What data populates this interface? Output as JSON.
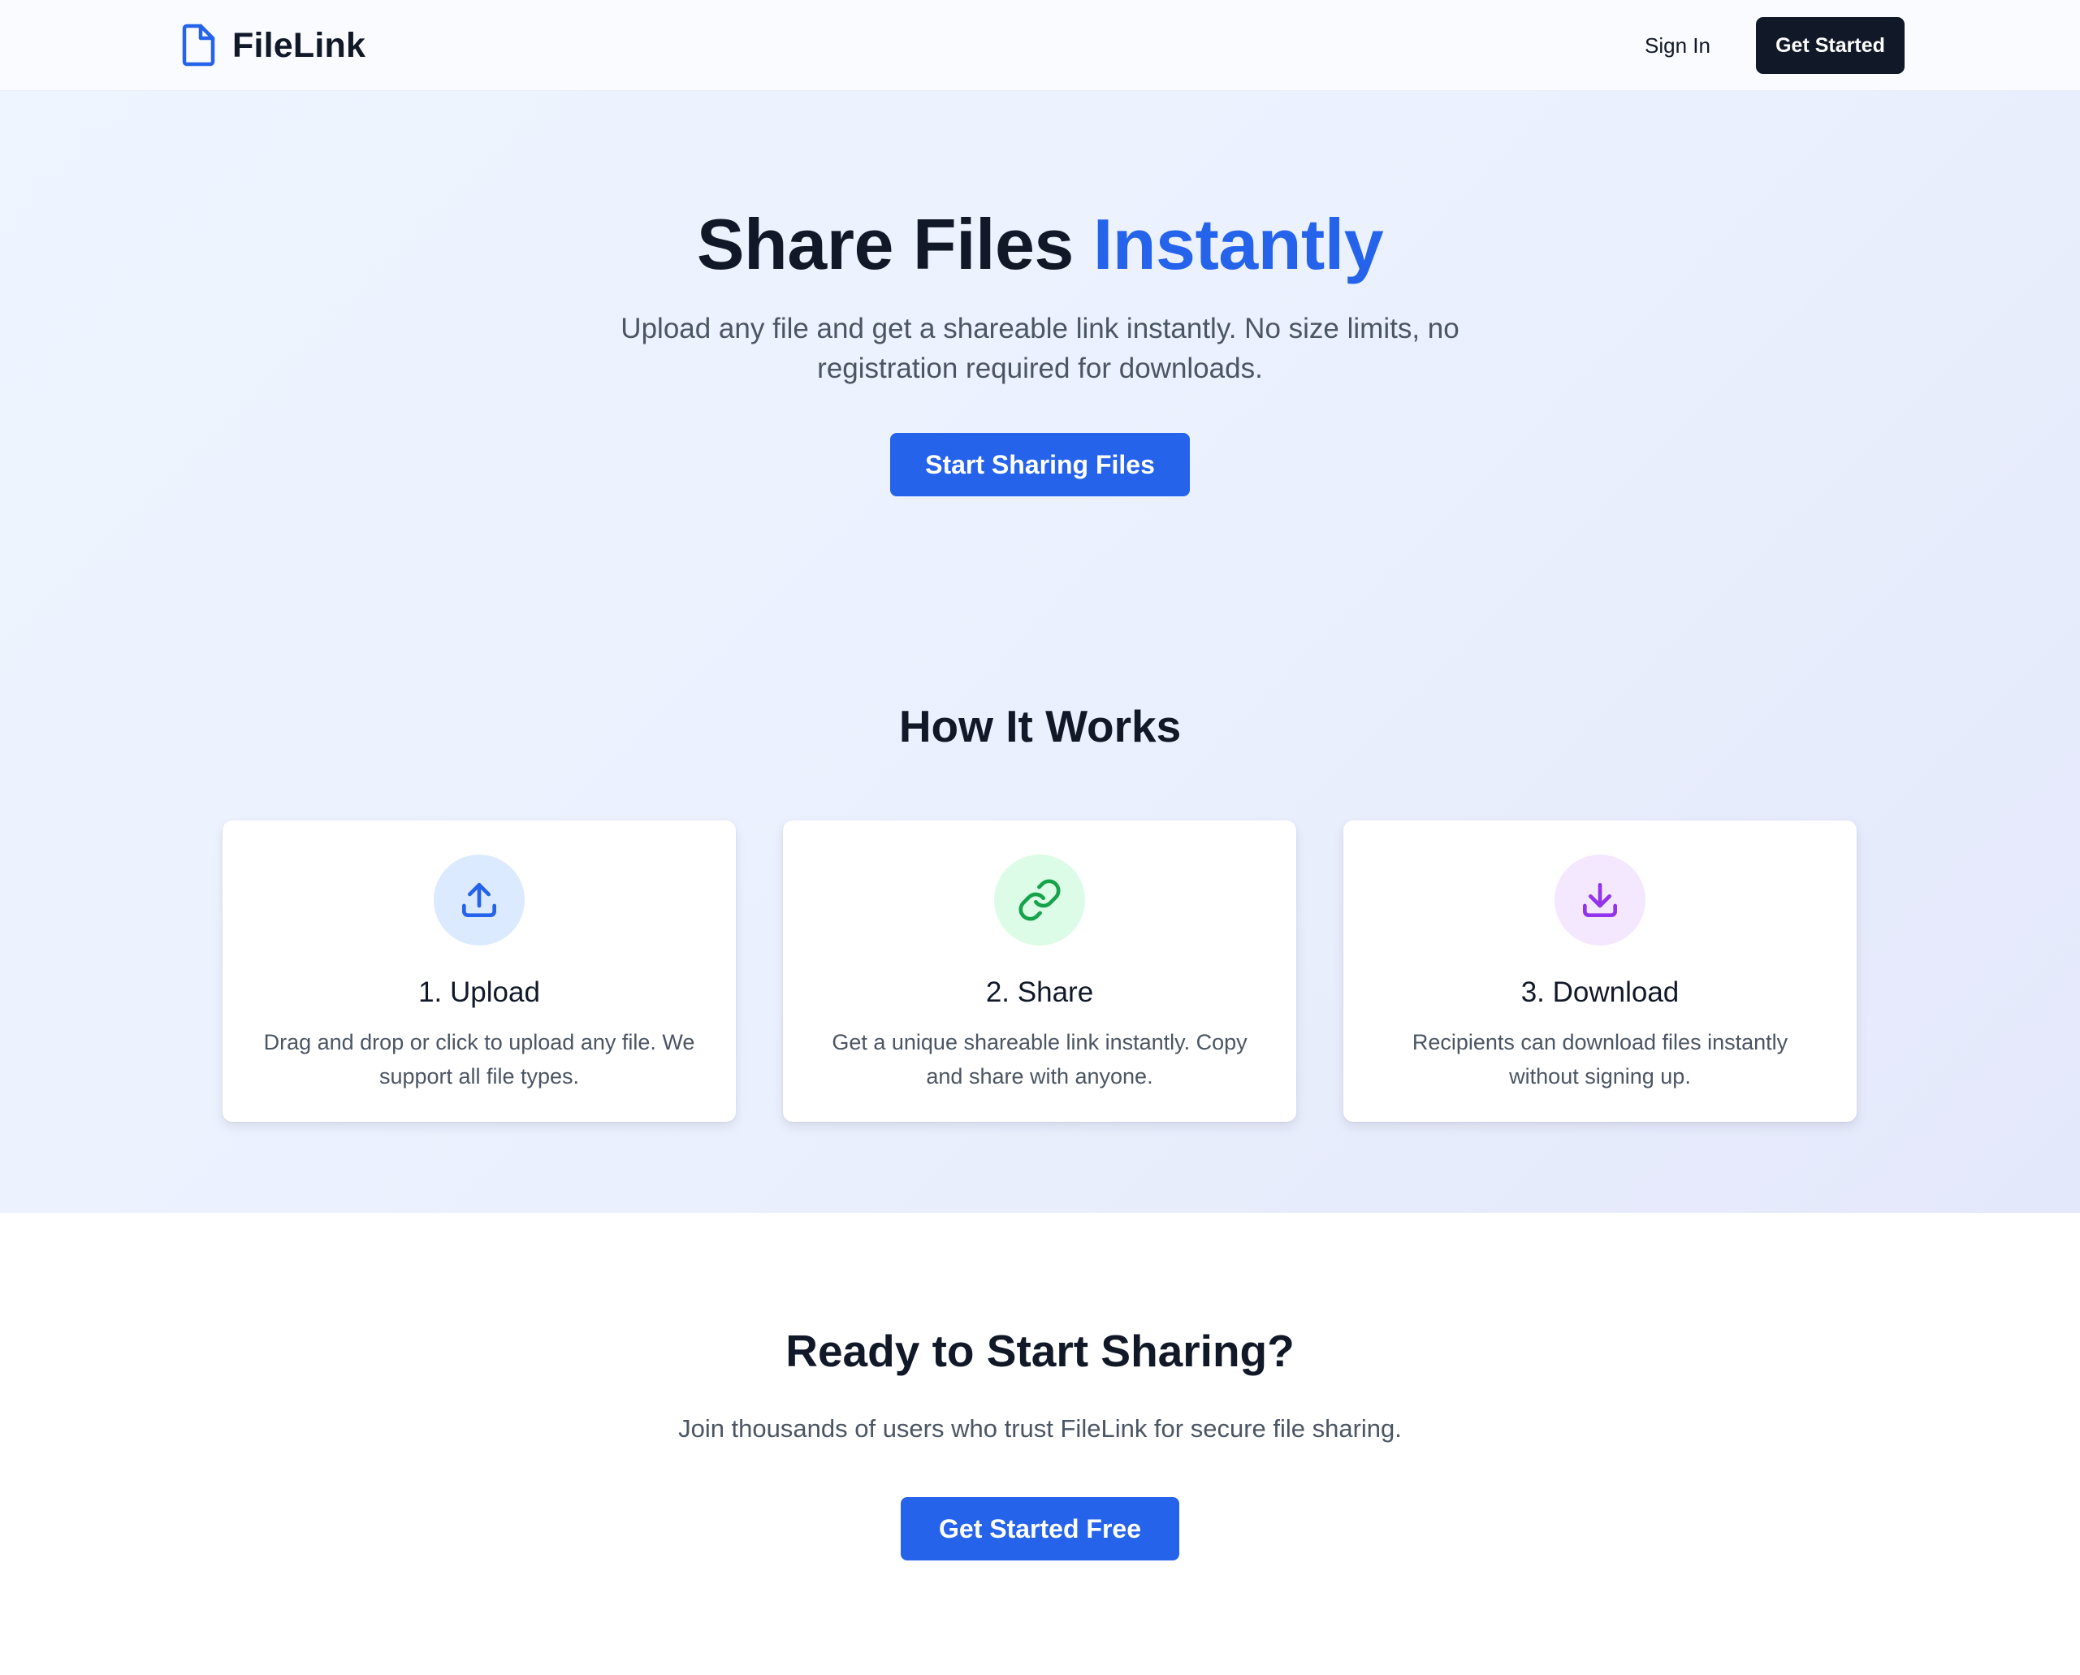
{
  "header": {
    "brand": "FileLink",
    "sign_in": "Sign In",
    "get_started": "Get Started"
  },
  "hero": {
    "title_main": "Share Files ",
    "title_accent": "Instantly",
    "subtitle": "Upload any file and get a shareable link instantly. No size limits, no registration required for downloads.",
    "button": "Start Sharing Files"
  },
  "how": {
    "title": "How It Works",
    "steps": [
      {
        "icon": "upload-icon",
        "title": "1. Upload",
        "text": "Drag and drop or click to upload any file. We support all file types."
      },
      {
        "icon": "link-icon",
        "title": "2. Share",
        "text": "Get a unique shareable link instantly. Copy and share with anyone."
      },
      {
        "icon": "download-icon",
        "title": "3. Download",
        "text": "Recipients can download files instantly without signing up."
      }
    ]
  },
  "cta": {
    "title": "Ready to Start Sharing?",
    "subtitle": "Join thousands of users who trust FileLink for secure file sharing.",
    "button": "Get Started Free"
  },
  "colors": {
    "accent": "#2563eb",
    "dark": "#111827",
    "muted_text": "#4b5563",
    "upload_icon": "#2563eb",
    "share_icon": "#16a34a",
    "download_icon": "#9333ea"
  }
}
